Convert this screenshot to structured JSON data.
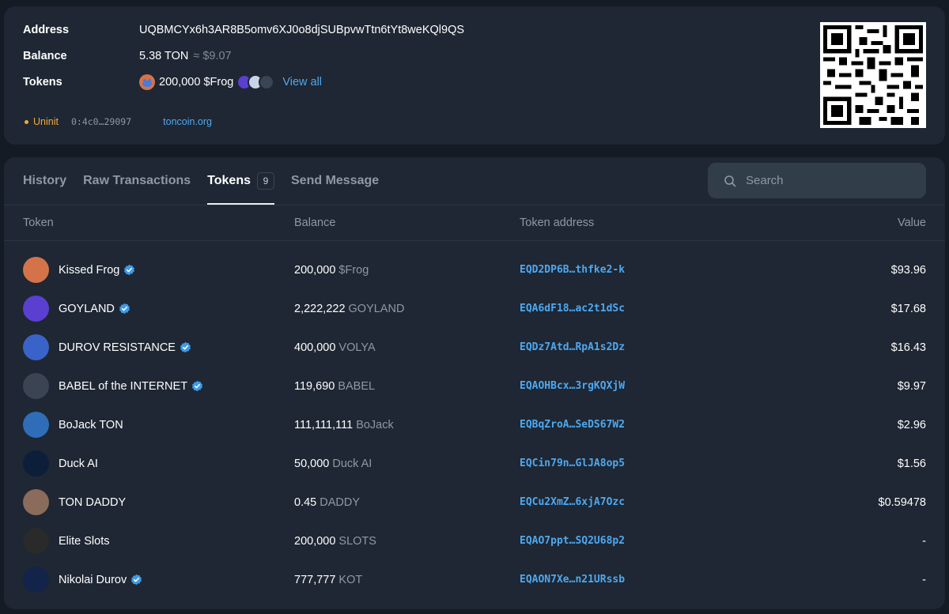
{
  "info": {
    "address_label": "Address",
    "address_value": "UQBMCYx6h3AR8B5omv6XJ0o8djSUBpvwTtn6tYt8weKQl9QS",
    "balance_label": "Balance",
    "balance_value": "5.38 TON",
    "balance_usd": "≈ $9.07",
    "tokens_label": "Tokens",
    "tokens_value": "200,000 $Frog",
    "view_all": "View all",
    "status": "Uninit",
    "raw_address": "0:4c0…29097",
    "site_link": "toncoin.org"
  },
  "tabs": [
    {
      "label": "History"
    },
    {
      "label": "Raw Transactions"
    },
    {
      "label": "Tokens",
      "count": "9",
      "active": true
    },
    {
      "label": "Send Message"
    }
  ],
  "search": {
    "placeholder": "Search"
  },
  "table": {
    "headers": {
      "token": "Token",
      "balance": "Balance",
      "address": "Token address",
      "value": "Value"
    },
    "rows": [
      {
        "name": "Kissed Frog",
        "verified": true,
        "amount": "200,000",
        "symbol": "$Frog",
        "address": "EQD2DP6B…thfke2-k",
        "value": "$93.96",
        "icon": "frog-icon",
        "color": "#d4734a"
      },
      {
        "name": "GOYLAND",
        "verified": true,
        "amount": "2,222,222",
        "symbol": "GOYLAND",
        "address": "EQA6dF18…ac2t1dSc",
        "value": "$17.68",
        "icon": "goyland-icon",
        "color": "#5b3fd1"
      },
      {
        "name": "DUROV RESISTANCE",
        "verified": true,
        "amount": "400,000",
        "symbol": "VOLYA",
        "address": "EQDz7Atd…RpA1s2Dz",
        "value": "$16.43",
        "icon": "durov-resistance-icon",
        "color": "#3a63c9"
      },
      {
        "name": "BABEL of the INTERNET",
        "verified": true,
        "amount": "119,690",
        "symbol": "BABEL",
        "address": "EQAOHBcx…3rgKQXjW",
        "value": "$9.97",
        "icon": "babel-icon",
        "color": "#3a4452"
      },
      {
        "name": "BoJack TON",
        "verified": false,
        "amount": "111,111,111",
        "symbol": "BoJack",
        "address": "EQBqZroA…SeDS67W2",
        "value": "$2.96",
        "icon": "bojack-icon",
        "color": "#2f6db8"
      },
      {
        "name": "Duck AI",
        "verified": false,
        "amount": "50,000",
        "symbol": "Duck AI",
        "address": "EQCin79n…GlJA8op5",
        "value": "$1.56",
        "icon": "duck-icon",
        "color": "#0d1e3a"
      },
      {
        "name": "TON DADDY",
        "verified": false,
        "amount": "0.45",
        "symbol": "DADDY",
        "address": "EQCu2XmZ…6xjA7Ozc",
        "value": "$0.59478",
        "icon": "daddy-icon",
        "color": "#8a6b5c"
      },
      {
        "name": "Elite Slots",
        "verified": false,
        "amount": "200,000",
        "symbol": "SLOTS",
        "address": "EQAO7ppt…SQ2U68p2",
        "value": "-",
        "icon": "slots-icon",
        "color": "#2a2a2a"
      },
      {
        "name": "Nikolai Durov",
        "verified": true,
        "amount": "777,777",
        "symbol": "KOT",
        "address": "EQAON7Xe…n21URssb",
        "value": "-",
        "icon": "kot-icon",
        "color": "#12244a"
      }
    ]
  },
  "colors": {
    "accent": "#4ea8f0",
    "status_uninit": "#f2a93b",
    "card": "#1e2733",
    "page": "#151b24"
  }
}
